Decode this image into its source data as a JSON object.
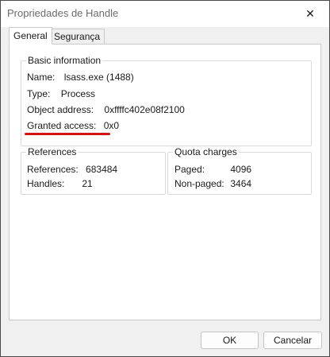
{
  "window": {
    "title": "Propriedades de Handle",
    "close_glyph": "✕"
  },
  "tabs": [
    {
      "label": "General",
      "active": true
    },
    {
      "label": "Segurança",
      "active": false
    }
  ],
  "basic_info": {
    "title": "Basic information",
    "name_label": "Name:",
    "name_value": "lsass.exe (1488)",
    "type_label": "Type:",
    "type_value": "Process",
    "object_address_label": "Object address:",
    "object_address_value": "0xffffc402e08f2100",
    "granted_access_label": "Granted access:",
    "granted_access_value": "0x0"
  },
  "references": {
    "title": "References",
    "references_label": "References:",
    "references_value": "683484",
    "handles_label": "Handles:",
    "handles_value": "21"
  },
  "quota_charges": {
    "title": "Quota charges",
    "paged_label": "Paged:",
    "paged_value": "4096",
    "nonpaged_label": "Non-paged:",
    "nonpaged_value": "3464"
  },
  "footer": {
    "ok_label": "OK",
    "cancel_label": "Cancelar"
  },
  "colors": {
    "highlight": "#d21414",
    "window_bg": "#f0f0f0",
    "panel_bg": "#ffffff"
  }
}
